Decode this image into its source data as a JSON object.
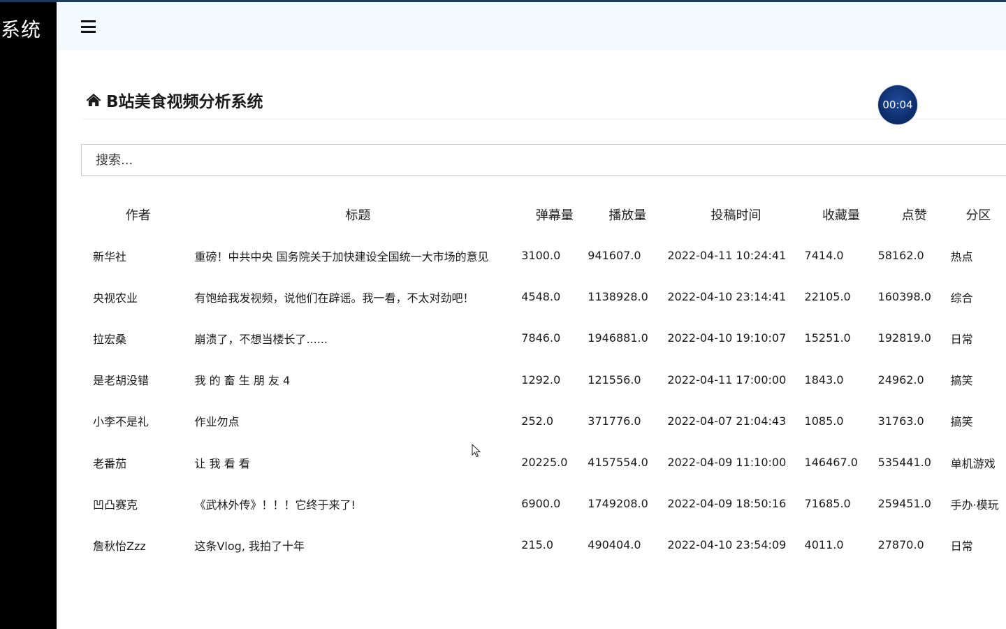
{
  "sidebar": {
    "title": "系统"
  },
  "topbar": {
    "menu_icon": "bars-icon"
  },
  "header": {
    "icon": "home-icon",
    "title": "B站美食视频分析系统"
  },
  "timer": {
    "label": "00:04"
  },
  "search": {
    "placeholder": "搜索..."
  },
  "table": {
    "columns": [
      "作者",
      "标题",
      "弹幕量",
      "播放量",
      "投稿时间",
      "收藏量",
      "点赞",
      "分区"
    ],
    "rows": [
      [
        "新华社",
        "重磅！中共中央 国务院关于加快建设全国统一大市场的意见",
        "3100.0",
        "941607.0",
        "2022-04-11 10:24:41",
        "7414.0",
        "58162.0",
        "热点"
      ],
      [
        "央视农业",
        "有饱给我发视频，说他们在辟谣。我一看，不太对劲吧！",
        "4548.0",
        "1138928.0",
        "2022-04-10 23:14:41",
        "22105.0",
        "160398.0",
        "综合"
      ],
      [
        "拉宏桑",
        "崩溃了，不想当楼长了......",
        "7846.0",
        "1946881.0",
        "2022-04-10 19:10:07",
        "15251.0",
        "192819.0",
        "日常"
      ],
      [
        "是老胡没错",
        "我 的 畜 生 朋 友 4",
        "1292.0",
        "121556.0",
        "2022-04-11 17:00:00",
        "1843.0",
        "24962.0",
        "搞笑"
      ],
      [
        "小李不是礼",
        "作业勿点",
        "252.0",
        "371776.0",
        "2022-04-07 21:04:43",
        "1085.0",
        "31763.0",
        "搞笑"
      ],
      [
        "老番茄",
        "让 我 看 看",
        "20225.0",
        "4157554.0",
        "2022-04-09 11:10:00",
        "146467.0",
        "535441.0",
        "单机游戏"
      ],
      [
        "凹凸赛克",
        "《武林外传》！！！它终于来了!",
        "6900.0",
        "1749208.0",
        "2022-04-09 18:50:16",
        "71685.0",
        "259451.0",
        "手办·模玩"
      ],
      [
        "詹秋怡Zzz",
        "这条Vlog, 我拍了十年",
        "215.0",
        "490404.0",
        "2022-04-10 23:54:09",
        "4011.0",
        "27870.0",
        "日常"
      ]
    ]
  }
}
